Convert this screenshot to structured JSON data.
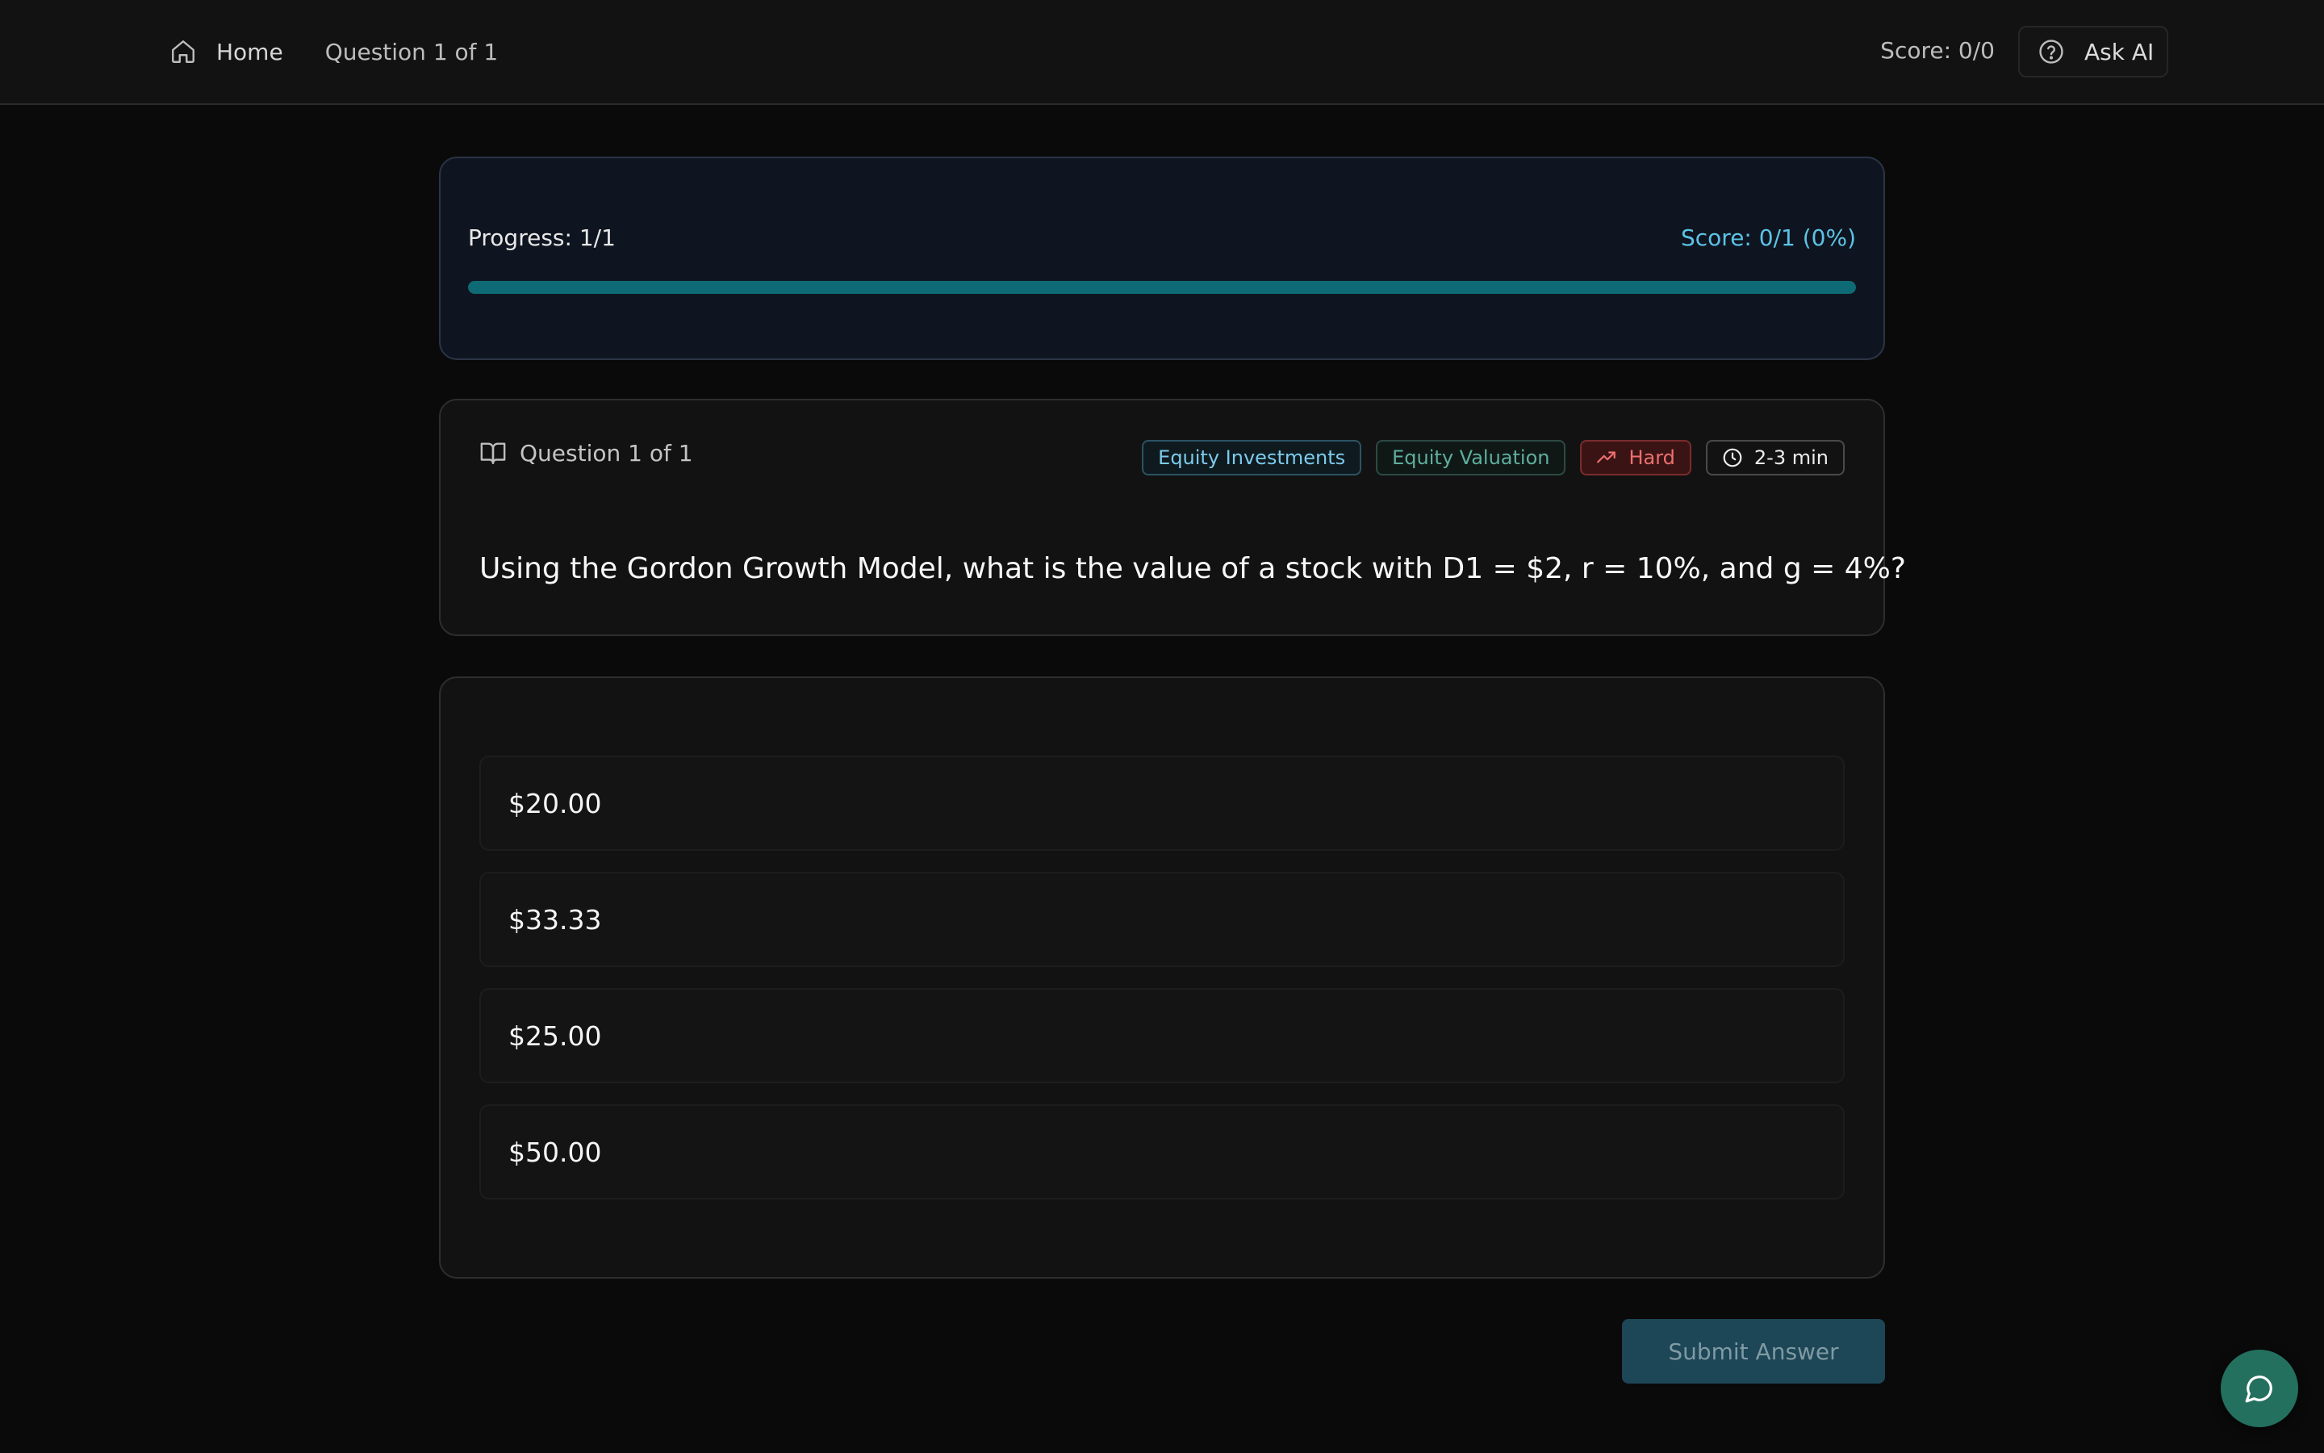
{
  "nav": {
    "home_label": "Home",
    "breadcrumb": "Question 1 of 1",
    "score": "Score: 0/0",
    "ask_ai_label": "Ask AI"
  },
  "progress": {
    "label": "Progress: 1/1",
    "score": "Score: 0/1 (0%)",
    "fraction": 1.0
  },
  "question": {
    "counter": "Question 1 of 1",
    "badges": {
      "topic": "Equity Investments",
      "subtopic": "Equity Valuation",
      "difficulty": "Hard",
      "time": "2-3 min"
    },
    "text": "Using the Gordon Growth Model, what is the value of a stock with D1 = $2, r = 10%, and g = 4%?"
  },
  "options": [
    {
      "label": "$20.00"
    },
    {
      "label": "$33.33"
    },
    {
      "label": "$25.00"
    },
    {
      "label": "$50.00"
    }
  ],
  "submit_label": "Submit Answer",
  "colors": {
    "accent": "#5cc3e6",
    "progress_fill": "#0e6b76",
    "hard": "#ef6f6f",
    "submit_bg": "#1d4656",
    "fab_bg": "#24705f"
  },
  "icons": {
    "home": "home-icon",
    "help": "help-circle-icon",
    "book": "book-open-icon",
    "trend": "trending-up-icon",
    "clock": "clock-icon",
    "chat": "message-circle-icon"
  }
}
